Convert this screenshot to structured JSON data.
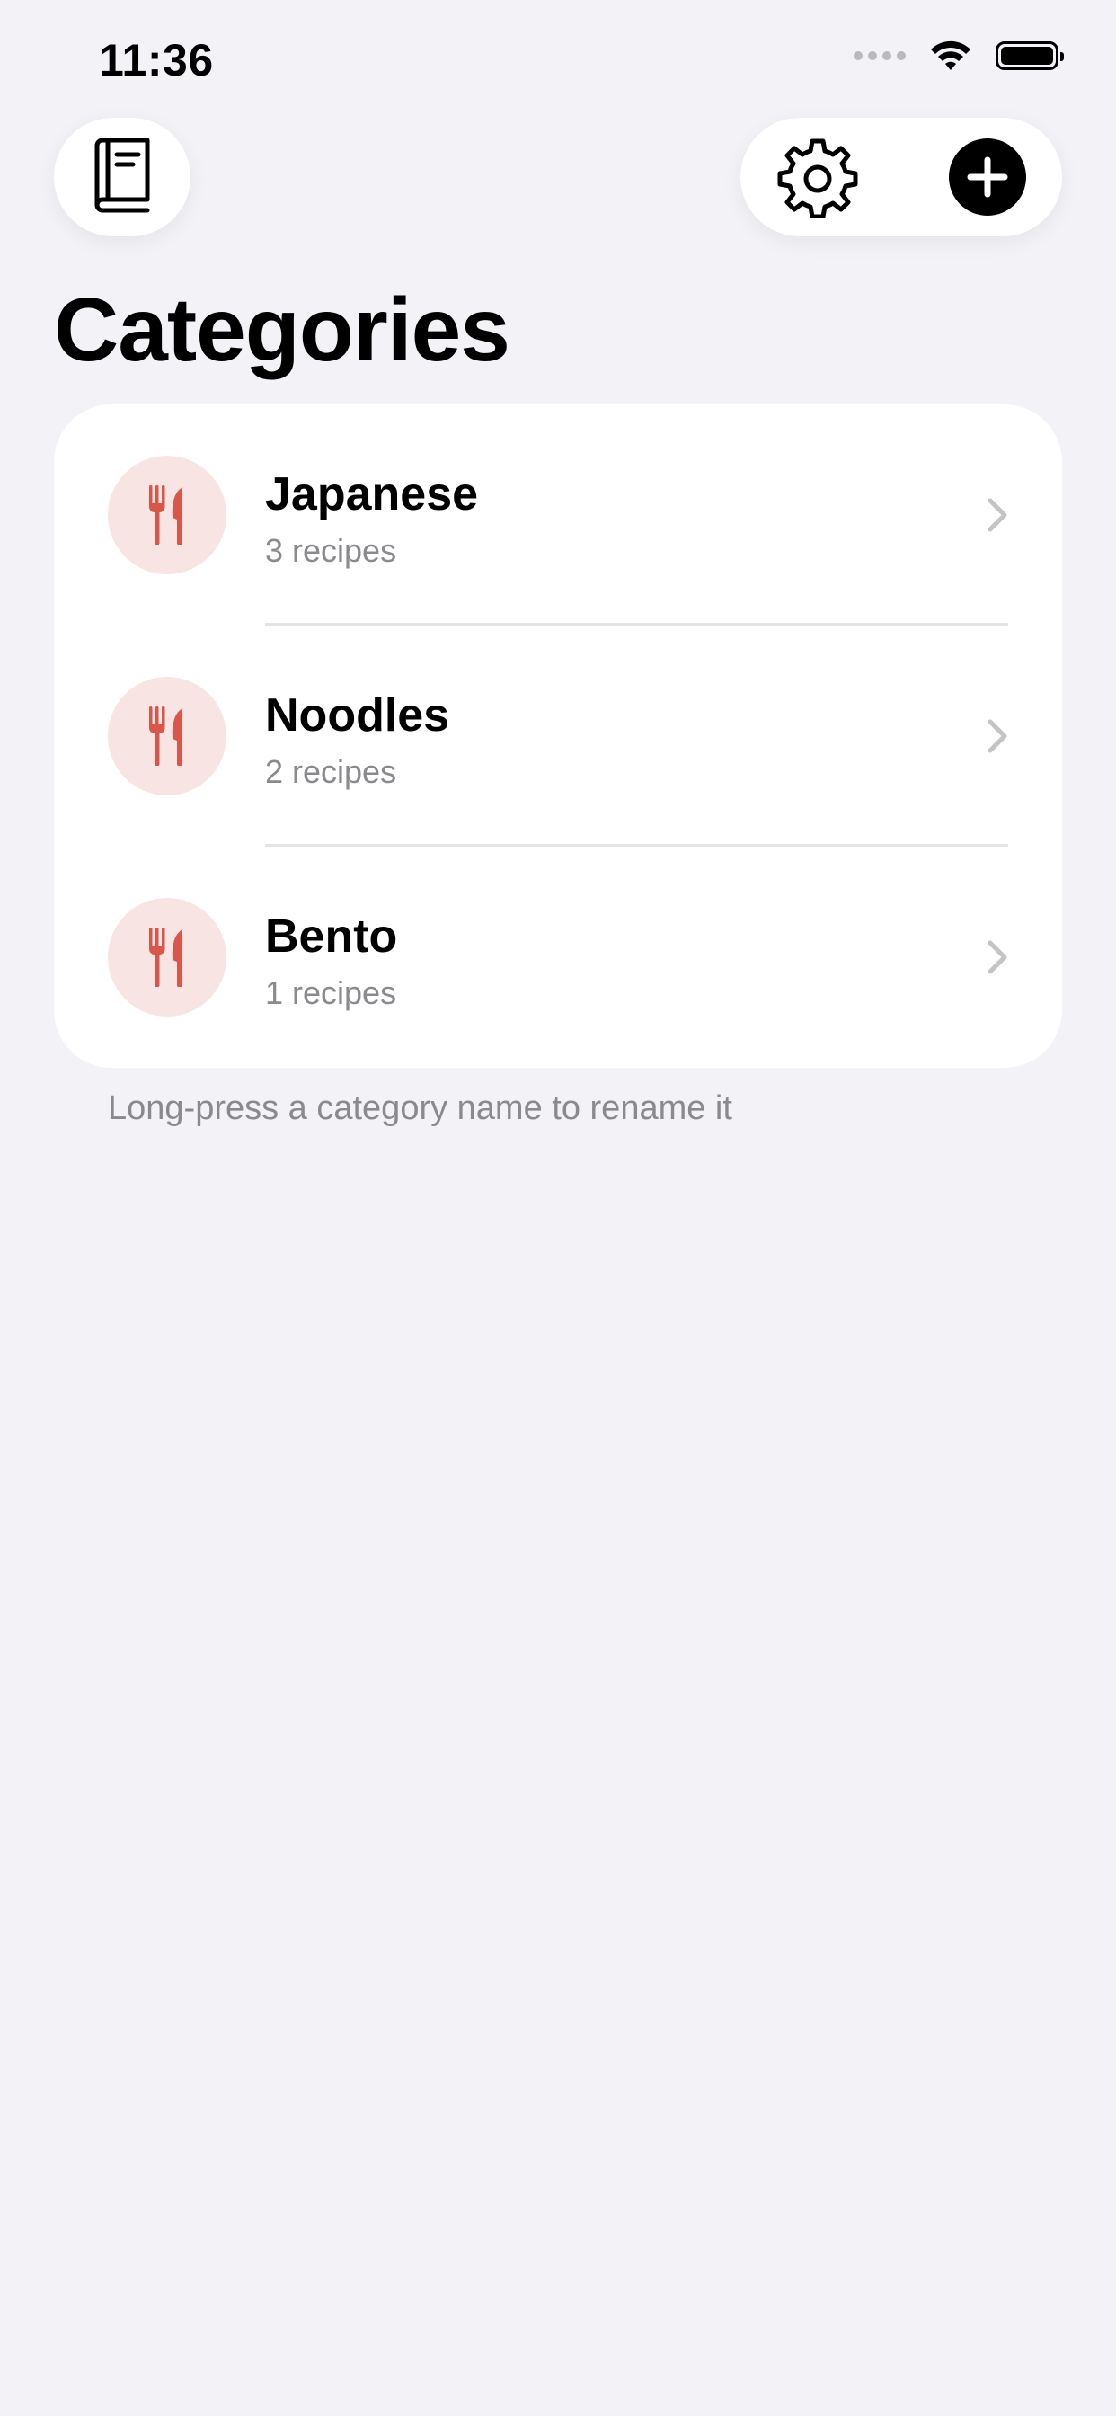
{
  "status_bar": {
    "time": "11:36"
  },
  "toolbar": {
    "book_icon": "book-icon",
    "settings_icon": "gear-icon",
    "add_icon": "plus-circle-icon"
  },
  "page": {
    "title": "Categories"
  },
  "categories": [
    {
      "name": "Japanese",
      "count": "3 recipes",
      "icon": "fork-knife-icon"
    },
    {
      "name": "Noodles",
      "count": "2 recipes",
      "icon": "fork-knife-icon"
    },
    {
      "name": "Bento",
      "count": "1 recipes",
      "icon": "fork-knife-icon"
    }
  ],
  "hint": "Long-press a category name to rename it",
  "colors": {
    "background": "#f2f2f7",
    "accent": "#d9574a",
    "badge_bg": "#f8e4e2",
    "secondary_text": "#8a8a8e"
  }
}
